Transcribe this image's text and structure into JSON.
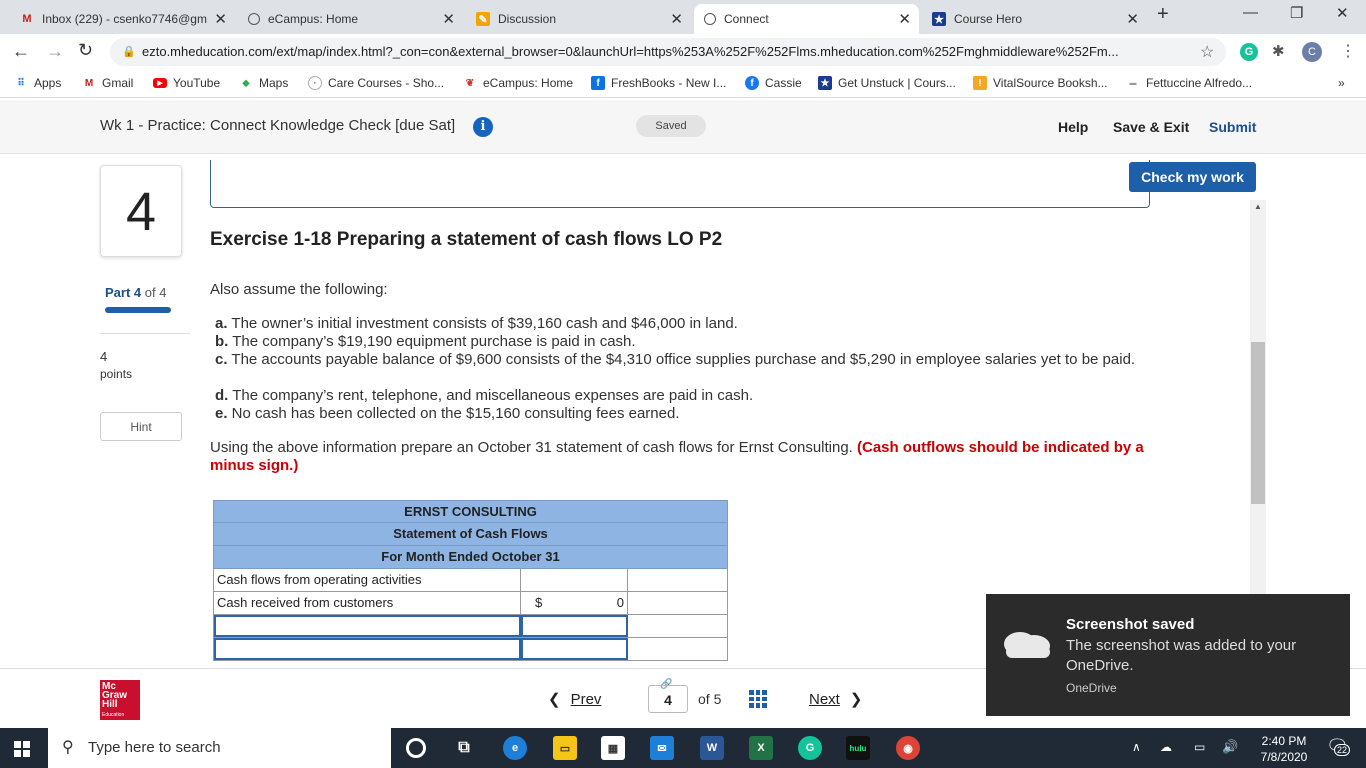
{
  "browser": {
    "tabs": [
      {
        "title": "Inbox (229) - csenko7746@gm",
        "favicon": "gmail-icon",
        "color": "#c5221f"
      },
      {
        "title": "eCampus: Home",
        "favicon": "globe-icon",
        "color": "#555"
      },
      {
        "title": "Discussion",
        "favicon": "pencil-icon",
        "color": "#f4a300"
      },
      {
        "title": "Connect",
        "favicon": "globe-icon",
        "color": "#555",
        "active": true
      },
      {
        "title": "Course Hero",
        "favicon": "star-icon",
        "color": "#1a3c8e"
      }
    ],
    "new_tab": "+",
    "url": "ezto.mheducation.com/ext/map/index.html?_con=con&external_browser=0&launchUrl=https%253A%252F%252Flms.mheducation.com%252Fmghmiddleware%252Fm...",
    "profile_initial": "C",
    "bookmarks": [
      {
        "label": "Apps",
        "icon": "apps-icon"
      },
      {
        "label": "Gmail",
        "icon": "gmail-icon"
      },
      {
        "label": "YouTube",
        "icon": "youtube-icon"
      },
      {
        "label": "Maps",
        "icon": "maps-icon"
      },
      {
        "label": "Care Courses - Sho...",
        "icon": "care-icon"
      },
      {
        "label": "eCampus: Home",
        "icon": "ecampus-icon"
      },
      {
        "label": "FreshBooks - New I...",
        "icon": "freshbooks-icon"
      },
      {
        "label": "Cassie",
        "icon": "facebook-icon"
      },
      {
        "label": "Get Unstuck | Cours...",
        "icon": "coursehero-icon"
      },
      {
        "label": "VitalSource Booksh...",
        "icon": "vitalsource-icon"
      },
      {
        "label": "Fettuccine Alfredo...",
        "icon": "recipe-icon"
      }
    ],
    "more": "»"
  },
  "header": {
    "title": "Wk 1 - Practice: Connect Knowledge Check [due Sat]",
    "info": "i",
    "saved": "Saved",
    "help": "Help",
    "save_exit": "Save & Exit",
    "submit": "Submit"
  },
  "sidebar": {
    "question_number": "4",
    "part_label": "Part 4",
    "part_of": " of 4",
    "points_value": "4",
    "points_label": "points",
    "hint": "Hint",
    "part_progress": 1.0
  },
  "main": {
    "check_button": "Check my work",
    "exercise_title": "Exercise 1-18 Preparing a statement of cash flows LO P2",
    "intro": "Also assume the following:",
    "items": [
      {
        "letter": "a.",
        "text": " The owner’s initial investment consists of $39,160 cash and $46,000 in land."
      },
      {
        "letter": "b.",
        "text": " The company’s $19,190 equipment purchase is paid in cash."
      },
      {
        "letter": "c.",
        "text": " The accounts payable balance of $9,600 consists of the $4,310 office supplies purchase and $5,290 in employee salaries yet to be paid."
      },
      {
        "letter": "d.",
        "text": " The company’s rent, telephone, and miscellaneous expenses are paid in cash."
      },
      {
        "letter": "e.",
        "text": " No cash has been collected on the $15,160 consulting fees earned."
      }
    ],
    "instruction": "Using the above information prepare an October 31 statement of cash flows for Ernst Consulting. ",
    "instruction_red": "(Cash outflows should be indicated by a minus sign.)"
  },
  "statement": {
    "company": "ERNST CONSULTING",
    "title": "Statement of Cash Flows",
    "period": "For Month Ended October 31",
    "rows": [
      {
        "label": "Cash flows from operating activities",
        "currency": "",
        "amount": ""
      },
      {
        "label": "Cash received from customers",
        "currency": "$",
        "amount": "0"
      }
    ]
  },
  "footer": {
    "logo_lines": [
      "Mc",
      "Graw",
      "Hill"
    ],
    "logo_small": "Education",
    "prev": "Prev",
    "page": "4",
    "of_total": "of 5",
    "next": "Next"
  },
  "toast": {
    "title": "Screenshot saved",
    "body": "The screenshot was added to your OneDrive.",
    "source": "OneDrive"
  },
  "taskbar": {
    "search_placeholder": "Type here to search",
    "time": "2:40 PM",
    "date": "7/8/2020",
    "notifications": "22"
  }
}
